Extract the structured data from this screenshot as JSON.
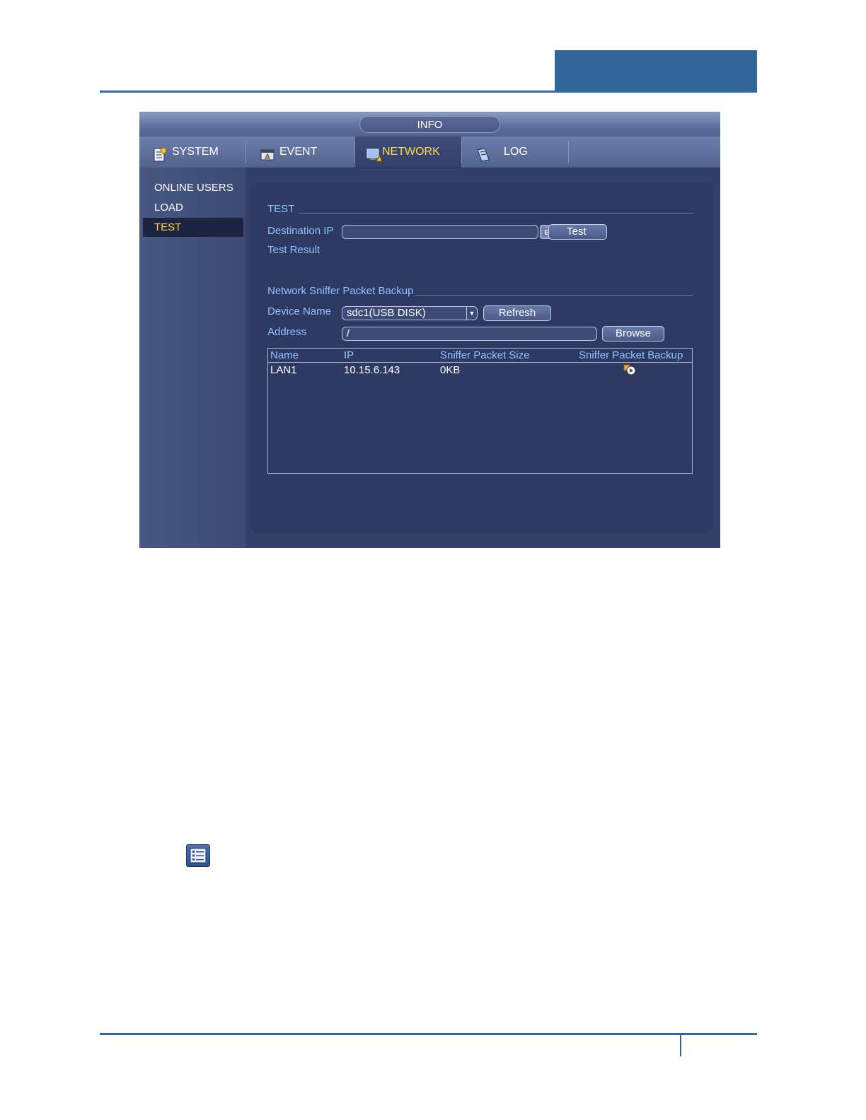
{
  "window": {
    "title": "INFO"
  },
  "tabs": [
    {
      "label": "SYSTEM",
      "icon": "system-icon"
    },
    {
      "label": "EVENT",
      "icon": "event-icon"
    },
    {
      "label": "NETWORK",
      "icon": "network-icon",
      "active": true
    },
    {
      "label": "LOG",
      "icon": "log-icon"
    }
  ],
  "sidebar": {
    "items": [
      {
        "label": "ONLINE USERS"
      },
      {
        "label": "LOAD"
      },
      {
        "label": "TEST",
        "active": true
      }
    ]
  },
  "test_section": {
    "title": "TEST",
    "destination_ip_label": "Destination IP",
    "destination_ip_value": "",
    "test_button": "Test",
    "test_result_label": "Test Result"
  },
  "sniffer_section": {
    "title": "Network Sniffer Packet Backup",
    "device_name_label": "Device Name",
    "device_name_value": "sdc1(USB DISK)",
    "refresh_button": "Refresh",
    "address_label": "Address",
    "address_value": "/",
    "browse_button": "Browse",
    "table": {
      "columns": [
        "Name",
        "IP",
        "Sniffer Packet Size",
        "Sniffer Packet Backup"
      ],
      "rows": [
        {
          "name": "LAN1",
          "ip": "10.15.6.143",
          "size": "0KB",
          "backup_icon": "backup-play-icon"
        }
      ]
    }
  },
  "colors": {
    "accent_blue": "#336699",
    "active_yellow": "#ffd84a",
    "label_blue": "#8ec3ff",
    "panel_bg": "#2f3a62"
  }
}
